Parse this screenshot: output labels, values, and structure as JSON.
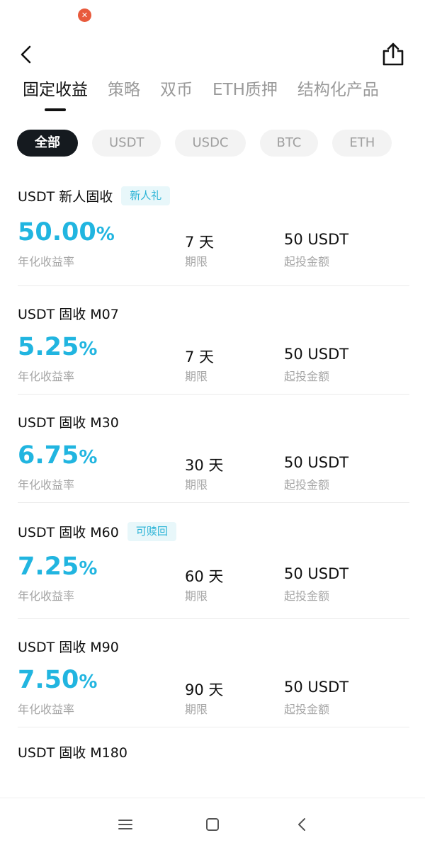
{
  "tabs": [
    {
      "label": "固定收益",
      "active": true
    },
    {
      "label": "策略"
    },
    {
      "label": "双币"
    },
    {
      "label": "ETH质押"
    },
    {
      "label": "结构化产品"
    }
  ],
  "chips": [
    {
      "label": "全部",
      "active": true
    },
    {
      "label": "USDT"
    },
    {
      "label": "USDC"
    },
    {
      "label": "BTC"
    },
    {
      "label": "ETH"
    }
  ],
  "labels": {
    "rate": "年化收益率",
    "term": "期限",
    "min": "起投金额"
  },
  "products": [
    {
      "name": "USDT 新人固收",
      "tag": "新人礼",
      "rate": "50.00",
      "pct": "%",
      "term": "7 天",
      "min": "50 USDT"
    },
    {
      "name": "USDT 固收 M07",
      "tag": "",
      "rate": "5.25",
      "pct": "%",
      "term": "7 天",
      "min": "50 USDT"
    },
    {
      "name": "USDT 固收 M30",
      "tag": "",
      "rate": "6.75",
      "pct": "%",
      "term": "30 天",
      "min": "50 USDT"
    },
    {
      "name": "USDT 固收 M60",
      "tag": "可赎回",
      "rate": "7.25",
      "pct": "%",
      "term": "60 天",
      "min": "50 USDT"
    },
    {
      "name": "USDT 固收 M90",
      "tag": "",
      "rate": "7.50",
      "pct": "%",
      "term": "90 天",
      "min": "50 USDT"
    },
    {
      "name": "USDT 固收 M180"
    }
  ],
  "icons": {
    "notification": "notification-icon",
    "back": "back-arrow-icon",
    "share": "share-icon",
    "menu": "menu-icon",
    "home": "home-icon",
    "nav_back": "nav-back-icon"
  },
  "colors": {
    "accent": "#21b5e0",
    "tag_bg": "#e8f7fa",
    "tag_text": "#2ab3d6",
    "chip_active": "#151a1f"
  }
}
